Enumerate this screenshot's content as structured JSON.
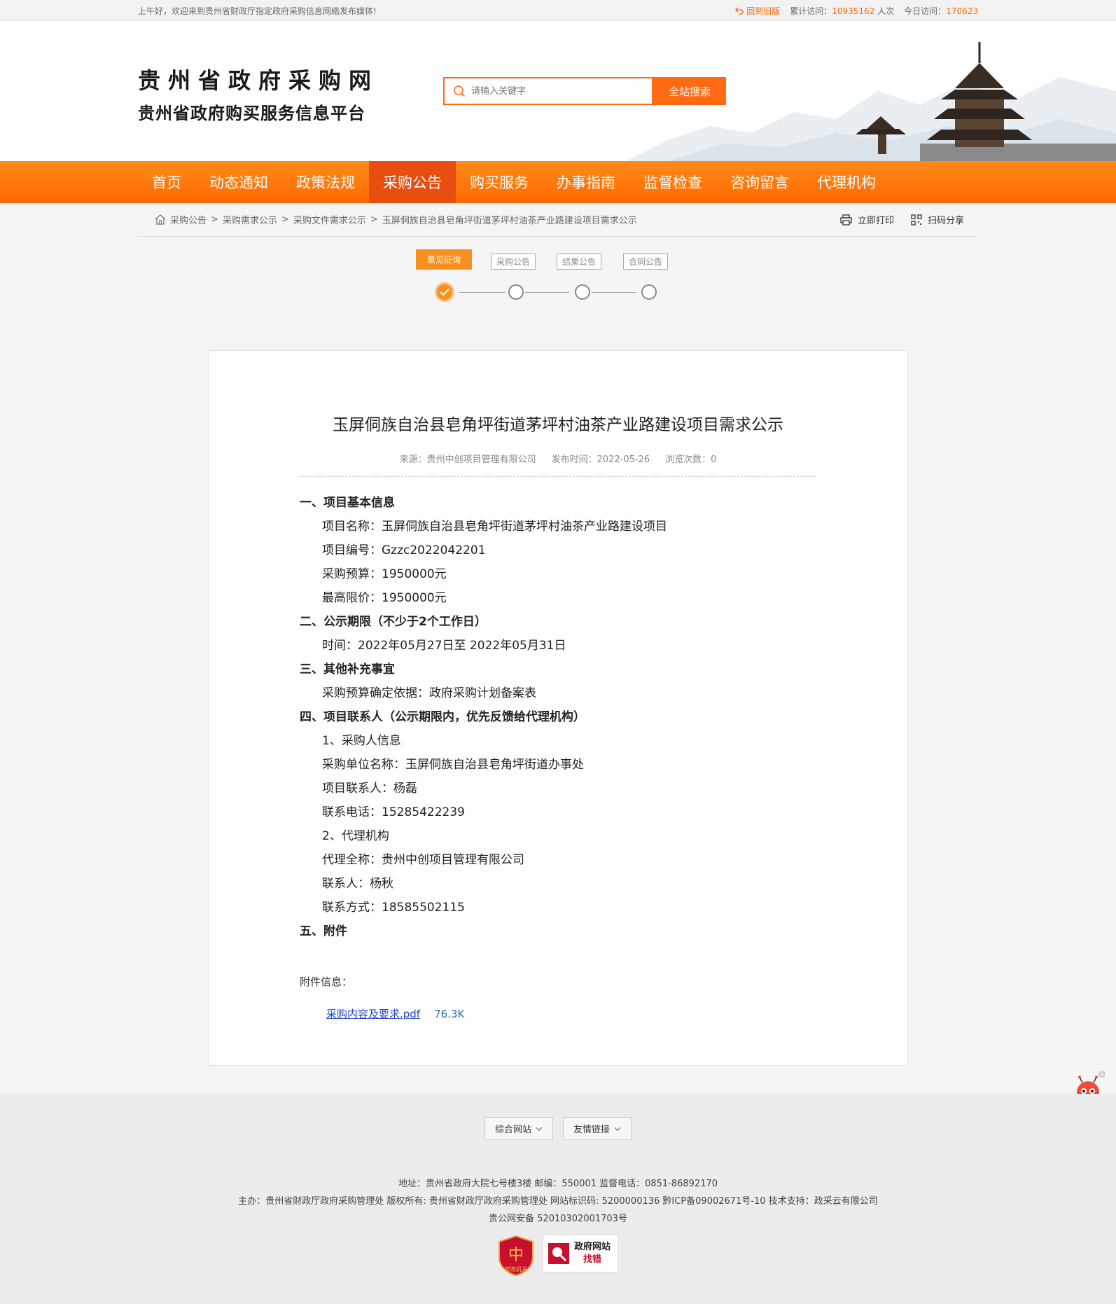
{
  "topbar": {
    "welcome": "上午好，欢迎来到贵州省财政厅指定政府采购信息网络发布媒体!",
    "back_old": "回到旧版",
    "visit_label": "累计访问：",
    "visit_count": "10935162",
    "visit_unit": "人次",
    "today_label": "今日访问：",
    "today_count": "170623"
  },
  "header": {
    "logo_line1": "贵州省政府采购网",
    "logo_line2": "贵州省政府购买服务信息平台",
    "search_placeholder": "请输入关键字",
    "search_button": "全站搜索"
  },
  "nav": {
    "items": [
      "首页",
      "动态通知",
      "政策法规",
      "采购公告",
      "购买服务",
      "办事指南",
      "监督检查",
      "咨询留言",
      "代理机构"
    ],
    "active_index": 3
  },
  "breadcrumb": {
    "items": [
      "采购公告",
      "采购需求公示",
      "采购文件需求公示",
      "玉屏侗族自治县皂角坪街道茅坪村油茶产业路建设项目需求公示"
    ],
    "print": "立即打印",
    "share": "扫码分享"
  },
  "steps": {
    "labels": [
      "意见征询",
      "采购公告",
      "结果公告",
      "合同公告"
    ],
    "active_index": 0
  },
  "article": {
    "title": "玉屏侗族自治县皂角坪街道茅坪村油茶产业路建设项目需求公示",
    "source": "来源：贵州中创项目管理有限公司",
    "publish": "发布时间：2022-05-26",
    "views": "浏览次数：0",
    "lines": [
      {
        "type": "h",
        "text": "一、项目基本信息"
      },
      {
        "type": "p",
        "text": "项目名称：玉屏侗族自治县皂角坪街道茅坪村油茶产业路建设项目"
      },
      {
        "type": "p",
        "text": "项目编号：Gzzc2022042201"
      },
      {
        "type": "p",
        "text": "采购预算：1950000元"
      },
      {
        "type": "p",
        "text": "最高限价：1950000元"
      },
      {
        "type": "h",
        "text": "二、公示期限（不少于2个工作日）"
      },
      {
        "type": "p",
        "text": "时间：2022年05月27日至 2022年05月31日"
      },
      {
        "type": "h",
        "text": "三、其他补充事宜"
      },
      {
        "type": "p",
        "text": "采购预算确定依据：政府采购计划备案表"
      },
      {
        "type": "h",
        "text": "四、项目联系人（公示期限内，优先反馈给代理机构）"
      },
      {
        "type": "p",
        "text": "1、采购人信息"
      },
      {
        "type": "p",
        "text": "采购单位名称：玉屏侗族自治县皂角坪街道办事处"
      },
      {
        "type": "p",
        "text": "项目联系人：杨磊"
      },
      {
        "type": "p",
        "text": "联系电话：15285422239"
      },
      {
        "type": "p",
        "text": "2、代理机构"
      },
      {
        "type": "p",
        "text": "代理全称：贵州中创项目管理有限公司"
      },
      {
        "type": "p",
        "text": "联系人：杨秋"
      },
      {
        "type": "p",
        "text": "联系方式：18585502115"
      },
      {
        "type": "h",
        "text": "五、附件"
      }
    ],
    "attach_title": "附件信息：",
    "attach_name": "采购内容及要求.pdf",
    "attach_size": "76.3K"
  },
  "footer": {
    "select1": "综合网站",
    "select2": "友情链接",
    "line1": "地址：贵州省政府大院七号楼3楼    邮编：550001    监督电话：0851-86892170",
    "line2": "主办：贵州省财政厅政府采购管理处    版权所有: 贵州省财政厅政府采购管理处    网站标识码: 5200000136    黔ICP备09002671号-10    技术支持：政采云有限公司",
    "line3": "贵公网安备 52010302001703号",
    "badge1": "党政机关",
    "badge2_line1": "政府网站",
    "badge2_line2": "找错"
  },
  "colors": {
    "brand_orange": "#ff6a13",
    "nav_active": "#e84e0f",
    "step_orange": "#f7901e"
  }
}
